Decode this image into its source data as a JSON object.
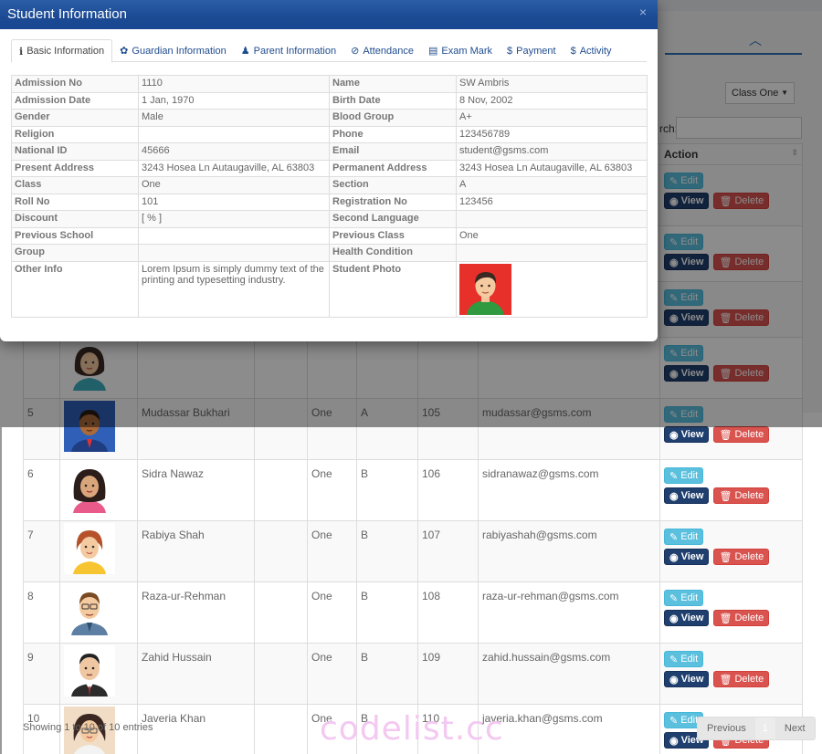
{
  "modal": {
    "title": "Student Information",
    "close": "×",
    "tabs": [
      {
        "label": "Basic Information",
        "icon": "info-circle-icon",
        "glyph": "ℹ"
      },
      {
        "label": "Guardian Information",
        "icon": "paw-icon",
        "glyph": "✿"
      },
      {
        "label": "Parent Information",
        "icon": "male-icon",
        "glyph": "♟"
      },
      {
        "label": "Attendance",
        "icon": "check-circle-icon",
        "glyph": "⊘"
      },
      {
        "label": "Exam Mark",
        "icon": "file-text-icon",
        "glyph": "▤"
      },
      {
        "label": "Payment",
        "icon": "dollar-icon",
        "glyph": "$"
      },
      {
        "label": "Activity",
        "icon": "dollar-icon",
        "glyph": "$"
      }
    ],
    "info_rows": [
      {
        "l1": "Admission No",
        "v1": "1110",
        "l2": "Name",
        "v2": "SW Ambris"
      },
      {
        "l1": "Admission Date",
        "v1": "1 Jan, 1970",
        "l2": "Birth Date",
        "v2": "8 Nov, 2002"
      },
      {
        "l1": "Gender",
        "v1": "Male",
        "l2": "Blood Group",
        "v2": "A+"
      },
      {
        "l1": "Religion",
        "v1": "",
        "l2": "Phone",
        "v2": "123456789"
      },
      {
        "l1": "National ID",
        "v1": "45666",
        "l2": "Email",
        "v2": "student@gsms.com"
      },
      {
        "l1": "Present Address",
        "v1": "3243 Hosea Ln Autaugaville, AL 63803",
        "l2": "Permanent Address",
        "v2": "3243 Hosea Ln Autaugaville, AL 63803"
      },
      {
        "l1": "Class",
        "v1": "One",
        "l2": "Section",
        "v2": "A"
      },
      {
        "l1": "Roll No",
        "v1": "101",
        "l2": "Registration No",
        "v2": "123456"
      },
      {
        "l1": "Discount",
        "v1": "[ % ]",
        "l2": "Second Language",
        "v2": ""
      },
      {
        "l1": "Previous School",
        "v1": "",
        "l2": "Previous Class",
        "v2": "One"
      },
      {
        "l1": "Group",
        "v1": "",
        "l2": "Health Condition",
        "v2": ""
      }
    ],
    "other_info": {
      "label": "Other Info",
      "value": "Lorem Ipsum is simply dummy text of the printing and typesetting industry.",
      "photo_label": "Student Photo"
    }
  },
  "background": {
    "class_select": "Class One",
    "search_label": "rch:",
    "action_header": "Action",
    "buttons": {
      "edit": "Edit",
      "view": "View",
      "delete": "Delete"
    },
    "students": [
      {
        "no": "",
        "name": "",
        "class": "",
        "section": "",
        "roll": "",
        "email": "",
        "avatar": "girl-1"
      },
      {
        "no": "",
        "name": "",
        "class": "",
        "section": "",
        "roll": "",
        "email": "",
        "avatar": "none"
      },
      {
        "no": "",
        "name": "",
        "class": "",
        "section": "",
        "roll": "",
        "email": "",
        "avatar": "none"
      },
      {
        "no": "",
        "name": "",
        "class": "",
        "section": "",
        "roll": "",
        "email": "",
        "avatar": "girl-1"
      },
      {
        "no": "5",
        "name": "Mudassar Bukhari",
        "class": "One",
        "section": "A",
        "roll": "105",
        "email": "mudassar@gsms.com",
        "avatar": "boy-blue"
      },
      {
        "no": "6",
        "name": "Sidra Nawaz",
        "class": "One",
        "section": "B",
        "roll": "106",
        "email": "sidranawaz@gsms.com",
        "avatar": "girl-dark"
      },
      {
        "no": "7",
        "name": "Rabiya Shah",
        "class": "One",
        "section": "B",
        "roll": "107",
        "email": "rabiyashah@gsms.com",
        "avatar": "girl-ponytail"
      },
      {
        "no": "8",
        "name": "Raza-ur-Rehman",
        "class": "One",
        "section": "B",
        "roll": "108",
        "email": "raza-ur-rehman@gsms.com",
        "avatar": "man-glasses"
      },
      {
        "no": "9",
        "name": "Zahid Hussain",
        "class": "One",
        "section": "B",
        "roll": "109",
        "email": "zahid.hussain@gsms.com",
        "avatar": "man-suit"
      },
      {
        "no": "10",
        "name": "Javeria Khan",
        "class": "One",
        "section": "B",
        "roll": "110",
        "email": "javeria.khan@gsms.com",
        "avatar": "woman-glasses"
      }
    ],
    "showing": "Showing 1 to 10 of 10 entries",
    "pager": {
      "previous": "Previous",
      "page": "1",
      "next": "Next"
    },
    "watermark": "codelist.cc"
  },
  "colors": {
    "modal_header": "#1b4a93",
    "edit": "#5bc0de",
    "view": "#1f3f6e",
    "delete": "#d9534f"
  }
}
